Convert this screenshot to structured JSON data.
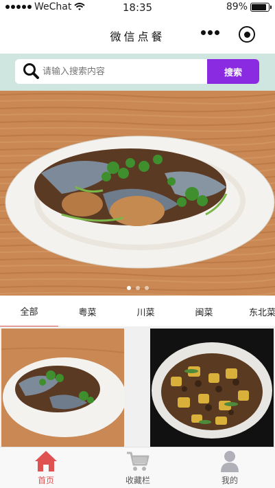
{
  "status_bar": {
    "carrier": "WeChat",
    "time": "18:35",
    "battery": "89%",
    "battery_level": 0.89
  },
  "nav": {
    "title": "微信点餐"
  },
  "search": {
    "placeholder": "请输入搜索内容",
    "button_label": "搜索"
  },
  "banner": {
    "slide_count": 3,
    "active_slide": 0
  },
  "categories": [
    "全部",
    "粤菜",
    "川菜",
    "闽菜",
    "东北菜"
  ],
  "active_category": 0,
  "tabbar": {
    "items": [
      {
        "label": "首页",
        "icon": "home-icon",
        "active": true
      },
      {
        "label": "收藏栏",
        "icon": "cart-icon",
        "active": false
      },
      {
        "label": "我的",
        "icon": "user-icon",
        "active": false
      }
    ]
  },
  "colors": {
    "accent": "#8a2be2",
    "tab_active": "#d9534f",
    "search_bg": "#cfe6e0",
    "tabbar_active": "#d9534f",
    "tabbar_inactive": "#555555"
  }
}
